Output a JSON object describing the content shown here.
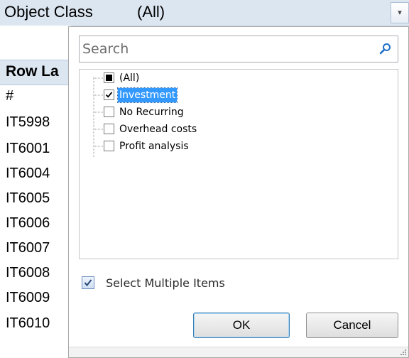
{
  "filter": {
    "field_label": "Object Class",
    "value_label": "(All)"
  },
  "rows": {
    "header": "Row La",
    "items": [
      "#",
      "IT5998",
      "IT6001",
      "IT6004",
      "IT6005",
      "IT6006",
      "IT6007",
      "IT6008",
      "IT6009",
      "IT6010"
    ]
  },
  "popup": {
    "search": {
      "placeholder": "Search",
      "value": ""
    },
    "items": [
      {
        "label": "(All)",
        "state": "indeterminate",
        "selected": false
      },
      {
        "label": "Investment",
        "state": "checked",
        "selected": true
      },
      {
        "label": "No Recurring",
        "state": "unchecked",
        "selected": false
      },
      {
        "label": "Overhead costs",
        "state": "unchecked",
        "selected": false
      },
      {
        "label": "Profit analysis",
        "state": "unchecked",
        "selected": false
      }
    ],
    "select_multiple": {
      "label": "Select Multiple Items",
      "checked": true
    },
    "ok_label": "OK",
    "cancel_label": "Cancel"
  },
  "colors": {
    "header_fill": "#dce6f1",
    "selection": "#3399ff",
    "search_icon": "#1f6fc6"
  }
}
